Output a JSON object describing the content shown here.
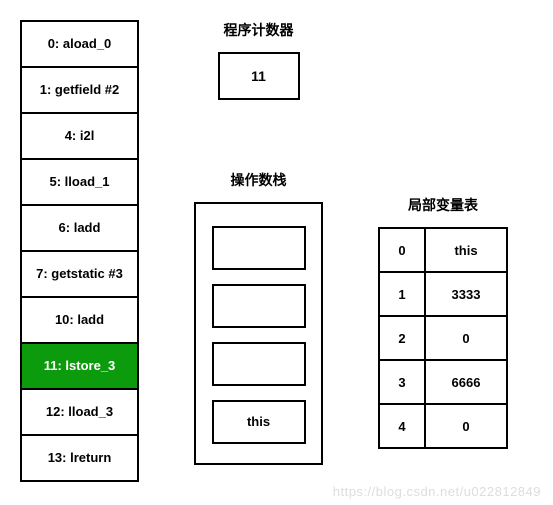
{
  "instructions": [
    {
      "text": "0: aload_0",
      "highlight": false
    },
    {
      "text": "1: getfield #2",
      "highlight": false
    },
    {
      "text": "4: i2l",
      "highlight": false
    },
    {
      "text": "5: lload_1",
      "highlight": false
    },
    {
      "text": "6: ladd",
      "highlight": false
    },
    {
      "text": "7: getstatic #3",
      "highlight": false
    },
    {
      "text": "10: ladd",
      "highlight": false
    },
    {
      "text": "11: lstore_3",
      "highlight": true
    },
    {
      "text": "12: lload_3",
      "highlight": false
    },
    {
      "text": "13: lreturn",
      "highlight": false
    }
  ],
  "program_counter": {
    "title": "程序计数器",
    "value": "11"
  },
  "operand_stack": {
    "title": "操作数栈",
    "slots": [
      "",
      "",
      "",
      "this"
    ]
  },
  "local_variable_table": {
    "title": "局部变量表",
    "rows": [
      {
        "index": "0",
        "value": "this"
      },
      {
        "index": "1",
        "value": "3333"
      },
      {
        "index": "2",
        "value": "0"
      },
      {
        "index": "3",
        "value": "6666"
      },
      {
        "index": "4",
        "value": "0"
      }
    ]
  },
  "watermark": "https://blog.csdn.net/u022812849"
}
